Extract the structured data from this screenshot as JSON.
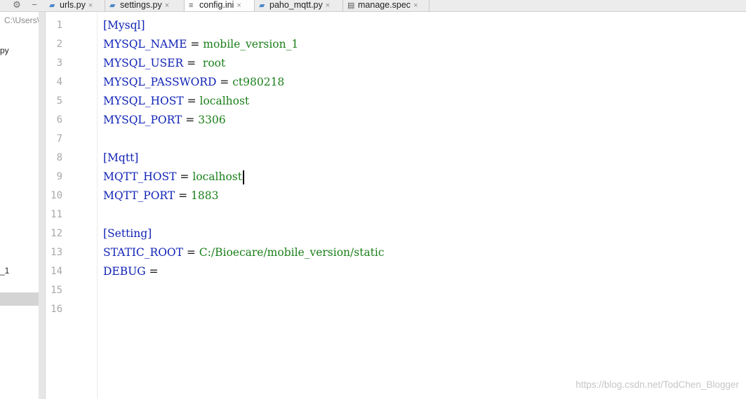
{
  "project_panel": {
    "path_text": "C:\\Users\\A",
    "item1_text": "py",
    "item2_text": "_1"
  },
  "tabs": [
    {
      "label": "urls.py",
      "icon": "python-file-icon"
    },
    {
      "label": "settings.py",
      "icon": "python-file-icon"
    },
    {
      "label": "config.ini",
      "icon": "ini-file-icon",
      "active": true
    },
    {
      "label": "paho_mqtt.py",
      "icon": "python-file-icon"
    },
    {
      "label": "manage.spec",
      "icon": "spec-file-icon"
    }
  ],
  "tab_close_glyph": "×",
  "line_numbers": [
    "1",
    "2",
    "3",
    "4",
    "5",
    "6",
    "7",
    "8",
    "9",
    "10",
    "11",
    "12",
    "13",
    "14",
    "15",
    "16"
  ],
  "code": {
    "l1": {
      "section": "[Mysql]"
    },
    "l2": {
      "key": "MYSQL_NAME",
      "eq": " = ",
      "value": "mobile_version_1"
    },
    "l3": {
      "key": "MYSQL_USER",
      "eq": " =  ",
      "value": "root"
    },
    "l4": {
      "key": "MYSQL_PASSWORD",
      "eq": " = ",
      "value": "ct980218"
    },
    "l5": {
      "key": "MYSQL_HOST",
      "eq": " = ",
      "value": "localhost"
    },
    "l6": {
      "key": "MYSQL_PORT",
      "eq": " = ",
      "value": "3306"
    },
    "l8": {
      "section": "[Mqtt]"
    },
    "l9": {
      "key": "MQTT_HOST",
      "eq": " = ",
      "value": "localhost"
    },
    "l10": {
      "key": "MQTT_PORT",
      "eq": " = ",
      "value": "1883"
    },
    "l12": {
      "section": "[Setting]"
    },
    "l13": {
      "key": "STATIC_ROOT",
      "eq": " = ",
      "value": "C:/Bioecare/mobile_version/static"
    },
    "l14": {
      "key": "DEBUG",
      "eq": " ="
    }
  },
  "current_line": 9,
  "watermark": "https://blog.csdn.net/TodChen_Blogger",
  "colors": {
    "key": "#0f22b5",
    "value": "#1a7f1a",
    "caret_row": "#fdf8e3",
    "line_number": "#a8a8a8"
  }
}
